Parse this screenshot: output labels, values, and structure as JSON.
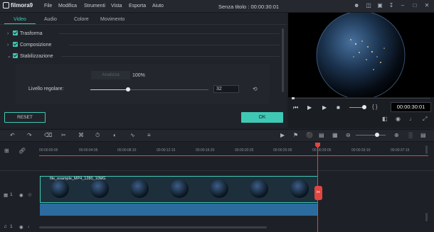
{
  "app": {
    "logo": "filmora9",
    "title": "Senza titolo : 00:00:30:01"
  },
  "menu": [
    "File",
    "Modifica",
    "Strumenti",
    "Vista",
    "Esporta",
    "Aiuto"
  ],
  "tabs": [
    "Video",
    "Audio",
    "Colore",
    "Movimento"
  ],
  "sections": [
    {
      "label": "Trasforma",
      "chevron": "›"
    },
    {
      "label": "Composizione",
      "chevron": "›"
    },
    {
      "label": "Stabilizzazione",
      "chevron": "⌄"
    }
  ],
  "stabilization": {
    "analyze_label": "Analizza",
    "analyze_percent": "100%",
    "level_label": "Livello regolare:",
    "level_value": "32",
    "level_fraction": 0.32
  },
  "buttons": {
    "reset": "RESET",
    "ok": "OK"
  },
  "preview": {
    "timecode": "00:00:30:01",
    "braces": "{ }",
    "volume_level": 0.8
  },
  "timeline": {
    "ruler": [
      "00:00:00:00",
      "00:00:04:05",
      "00:00:08:10",
      "00:00:12:15",
      "00:00:16:20",
      "00:00:20:25",
      "00:00:25:00",
      "00:00:29:05",
      "00:00:33:10",
      "00:00:37:15"
    ],
    "clip_name": "file_example_MP4_1280_10MG",
    "track_video": "1",
    "track_audio": "1"
  },
  "colors": {
    "accent": "#3fc9b5",
    "playhead": "#e2453f",
    "audio": "#2b6b9e"
  }
}
